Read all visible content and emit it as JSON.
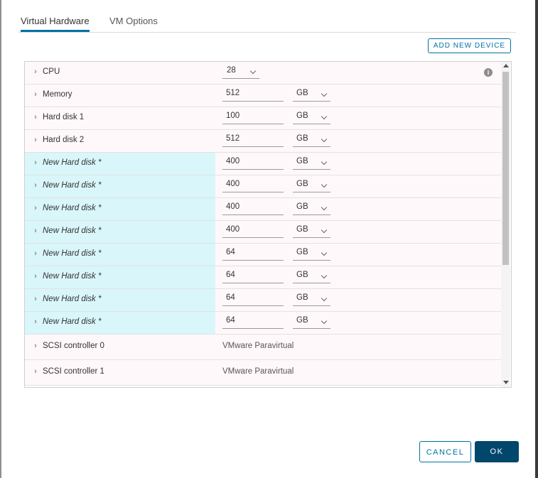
{
  "dialog": {
    "tabs": [
      {
        "label": "Virtual Hardware"
      },
      {
        "label": "VM Options"
      }
    ],
    "add_device_label": "ADD NEW DEVICE",
    "cancel_label": "CANCEL",
    "ok_label": "OK"
  },
  "hardware": {
    "cpu": {
      "label": "CPU",
      "value": "28"
    },
    "memory": {
      "label": "Memory",
      "value": "512",
      "unit": "GB"
    },
    "hard_disk_1": {
      "label": "Hard disk 1",
      "value": "100",
      "unit": "GB"
    },
    "hard_disk_2": {
      "label": "Hard disk 2",
      "value": "512",
      "unit": "GB"
    },
    "new_disks": [
      {
        "label": "New Hard disk *",
        "value": "400",
        "unit": "GB"
      },
      {
        "label": "New Hard disk *",
        "value": "400",
        "unit": "GB"
      },
      {
        "label": "New Hard disk *",
        "value": "400",
        "unit": "GB"
      },
      {
        "label": "New Hard disk *",
        "value": "400",
        "unit": "GB"
      },
      {
        "label": "New Hard disk *",
        "value": "64",
        "unit": "GB"
      },
      {
        "label": "New Hard disk *",
        "value": "64",
        "unit": "GB"
      },
      {
        "label": "New Hard disk *",
        "value": "64",
        "unit": "GB"
      },
      {
        "label": "New Hard disk *",
        "value": "64",
        "unit": "GB"
      }
    ],
    "scsi_0": {
      "label": "SCSI controller 0",
      "value": "VMware Paravirtual"
    },
    "scsi_1": {
      "label": "SCSI controller 1",
      "value": "VMware Paravirtual"
    }
  },
  "icons": {
    "info": "i",
    "chevron": "›"
  },
  "colors": {
    "accent": "#0072a3",
    "ok_button": "#00476b",
    "new_row_highlight": "#d9f6fa"
  }
}
